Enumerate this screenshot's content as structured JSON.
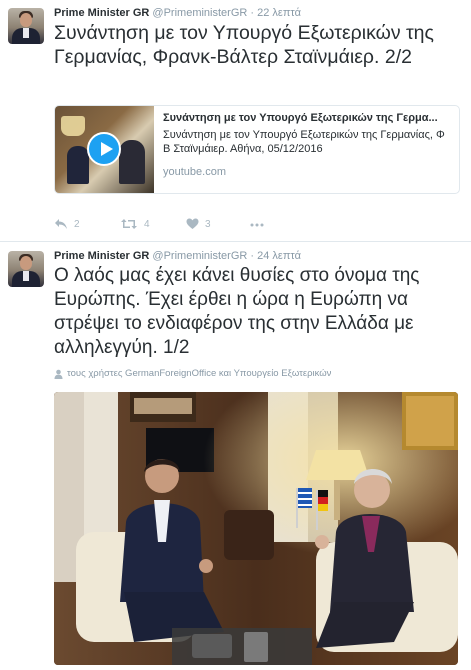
{
  "tweets": [
    {
      "author_name": "Prime Minister GR",
      "handle": "@PrimeministerGR",
      "separator": "·",
      "time": "22 λεπτά",
      "text": "Συνάντηση με τον Υπουργό Εξωτερικών της Γερμανίας, Φρανκ-Βάλτερ Σταϊνμάιερ. 2/2",
      "card": {
        "title": "Συνάντηση με τον Υπουργό Εξωτερικών της Γερμα...",
        "description": "Συνάντηση με τον Υπουργό Εξωτερικών της Γερμανίας, Φ Β Σταϊνμάιερ. Αθήνα, 05/12/2016",
        "domain": "youtube.com"
      },
      "actions": {
        "reply_count": "2",
        "retweet_count": "4",
        "like_count": "3"
      },
      "icons": [
        "reply-icon",
        "retweet-icon",
        "heart-icon",
        "more-icon"
      ]
    },
    {
      "author_name": "Prime Minister GR",
      "handle": "@PrimeministerGR",
      "separator": "·",
      "time": "24 λεπτά",
      "text": "Ο λαός μας έχει κάνει θυσίες στο όνομα της Ευρώπης. Έχει έρθει η ώρα η Ευρώπη να στρέψει το ενδιαφέρον της στην Ελλάδα με αλληλεγγύη. 1/2",
      "mention_line": "τους χρήστες GermanForeignOffice και Υπουργείο Εξωτερικών"
    }
  ],
  "colors": {
    "link_blue": "#1da1f2",
    "muted": "#8899a6",
    "text": "#292f33",
    "border": "#e1e8ed"
  }
}
